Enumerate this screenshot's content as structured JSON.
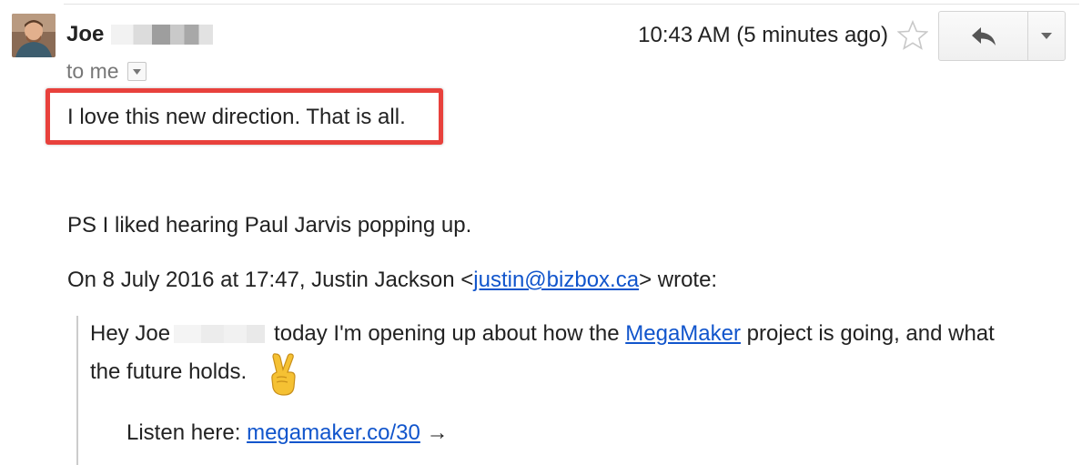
{
  "email": {
    "sender": {
      "first_name": "Joe",
      "avatar_icon": "user-avatar-photo"
    },
    "recipient_label": "to me",
    "timestamp": "10:43 AM (5 minutes ago)",
    "actions": {
      "star_icon": "star-outline-icon",
      "reply_icon": "reply-arrow-icon",
      "more_icon": "caret-down-icon"
    },
    "body": {
      "highlight_color": "#e8413c",
      "line1": "I love this new direction. That is all.",
      "line2": "PS I liked hearing Paul Jarvis popping up.",
      "quote_header": {
        "prefix": "On 8 July 2016 at 17:47, Justin Jackson <",
        "email_link": "justin@bizbox.ca",
        "suffix": "> wrote:"
      }
    },
    "quoted": {
      "greeting": "Hey Joe",
      "text_before_link": "today I'm opening up about how the",
      "link_text": "MegaMaker",
      "text_after_link": "project is going, and what",
      "line2": "the future holds.",
      "emoji_icon": "victory-hand-emoji",
      "listen_prefix": "Listen here:",
      "listen_link": "megamaker.co/30",
      "arrow": "→"
    },
    "link_color": "#1155cc"
  }
}
